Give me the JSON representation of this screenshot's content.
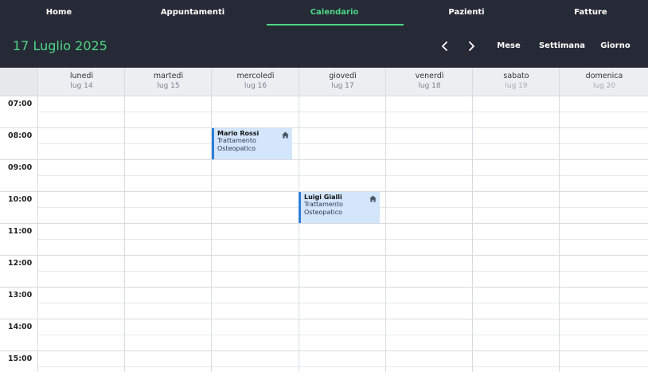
{
  "nav": {
    "items": [
      {
        "label": "Home",
        "active": false
      },
      {
        "label": "Appuntamenti",
        "active": false
      },
      {
        "label": "Calendario",
        "active": true
      },
      {
        "label": "Pazienti",
        "active": false
      },
      {
        "label": "Fatture",
        "active": false
      }
    ]
  },
  "header": {
    "title": "17 Luglio 2025",
    "prev_icon": "chevron-left-icon",
    "next_icon": "chevron-right-icon",
    "views": [
      "Mese",
      "Settimana",
      "Giorno"
    ]
  },
  "calendar": {
    "days": [
      {
        "name": "lunedì",
        "date": "lug 14"
      },
      {
        "name": "martedì",
        "date": "lug 15"
      },
      {
        "name": "mercoledì",
        "date": "lug 16"
      },
      {
        "name": "giovedì",
        "date": "lug 17"
      },
      {
        "name": "venerdì",
        "date": "lug 18"
      },
      {
        "name": "sabato",
        "date": "lug 19"
      },
      {
        "name": "domenica",
        "date": "lug 20"
      }
    ],
    "hours": [
      "07:00",
      "08:00",
      "09:00",
      "10:00",
      "11:00",
      "12:00",
      "13:00",
      "14:00",
      "15:00"
    ],
    "events": [
      {
        "name": "Mario Rossi",
        "description": "Trattamento Osteopatico",
        "day": "mercoledì",
        "start": "08:00",
        "end": "09:00",
        "icon": "home-icon"
      },
      {
        "name": "Luigi Gialli",
        "description": "Trattamento Osteopatico",
        "day": "giovedì",
        "start": "10:00",
        "end": "11:00",
        "icon": "home-icon"
      }
    ]
  },
  "colors": {
    "nav_bg": "#262a36",
    "accent": "#4ed685",
    "event_bg": "#d3e6fb",
    "event_border": "#2f7fd9"
  }
}
